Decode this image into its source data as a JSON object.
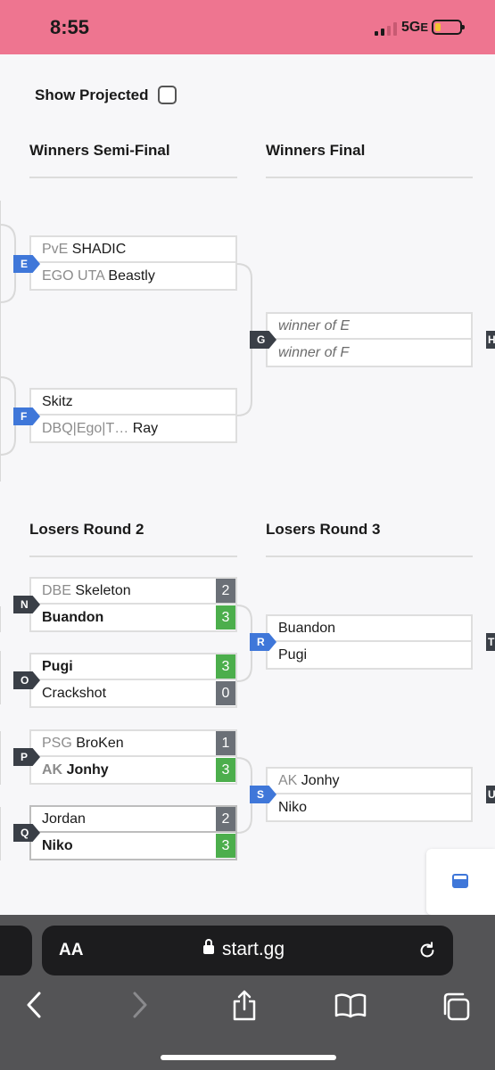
{
  "status_bar": {
    "time": "8:55",
    "network": "5G",
    "network_suffix": "E"
  },
  "toolbar": {
    "show_projected_label": "Show Projected"
  },
  "rounds": {
    "winners_semi": "Winners Semi-Final",
    "winners_final": "Winners Final",
    "losers_r2": "Losers Round 2",
    "losers_r3": "Losers Round 3"
  },
  "matches": {
    "E": {
      "tag": "E",
      "p1": {
        "prefix": "PvE",
        "name": "SHADIC"
      },
      "p2": {
        "prefix": "EGO UTA",
        "name": "Beastly"
      }
    },
    "F": {
      "tag": "F",
      "p1": {
        "prefix": "",
        "name": "Skitz"
      },
      "p2": {
        "prefix": "DBQ|Ego|T…",
        "name": "Ray"
      }
    },
    "G": {
      "tag": "G",
      "p1": {
        "name": "winner of E"
      },
      "p2": {
        "name": "winner of F"
      }
    },
    "N": {
      "tag": "N",
      "p1": {
        "prefix": "DBE",
        "name": "Skeleton",
        "score": "2"
      },
      "p2": {
        "prefix": "",
        "name": "Buandon",
        "score": "3"
      }
    },
    "O": {
      "tag": "O",
      "p1": {
        "prefix": "",
        "name": "Pugi",
        "score": "3"
      },
      "p2": {
        "prefix": "",
        "name": "Crackshot",
        "score": "0"
      }
    },
    "P": {
      "tag": "P",
      "p1": {
        "prefix": "PSG",
        "name": "BroKen",
        "score": "1"
      },
      "p2": {
        "prefix": "AK",
        "name": "Jonhy",
        "score": "3"
      }
    },
    "Q": {
      "tag": "Q",
      "p1": {
        "prefix": "",
        "name": "Jordan",
        "score": "2"
      },
      "p2": {
        "prefix": "",
        "name": "Niko",
        "score": "3"
      }
    },
    "R": {
      "tag": "R",
      "p1": {
        "prefix": "",
        "name": "Buandon"
      },
      "p2": {
        "prefix": "",
        "name": "Pugi"
      }
    },
    "S": {
      "tag": "S",
      "p1": {
        "prefix": "AK",
        "name": "Jonhy"
      },
      "p2": {
        "prefix": "",
        "name": "Niko"
      }
    }
  },
  "browser": {
    "aa_label": "AA",
    "url": "start.gg"
  },
  "colors": {
    "status_bar": "#ee7590",
    "tag_blue": "#3f77d9",
    "tag_dark": "#3a3f47",
    "score_win": "#4cae4c",
    "score_loss": "#6b7077"
  }
}
